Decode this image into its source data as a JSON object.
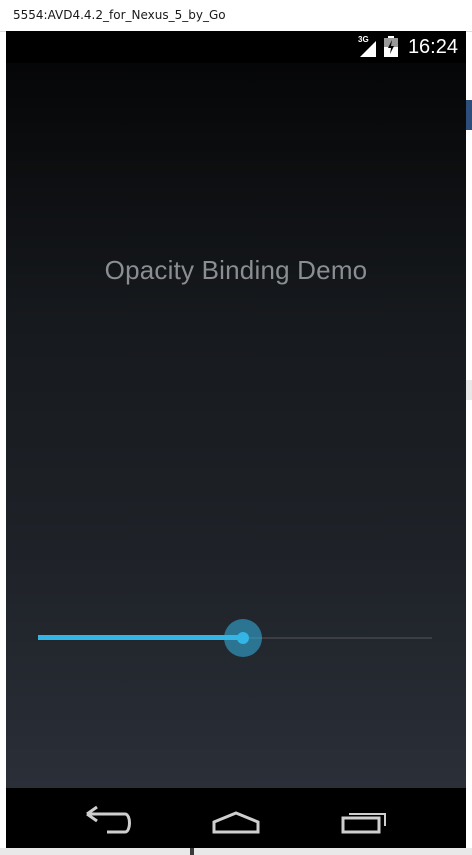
{
  "window": {
    "title": "5554:AVD4.4.2_for_Nexus_5_by_Go"
  },
  "statusbar": {
    "network": "3G",
    "time": "16:24",
    "icons": [
      "signal-icon",
      "battery-icon"
    ]
  },
  "app": {
    "title": "Opacity Binding Demo",
    "slider": {
      "value_fraction": 0.52,
      "accent": "#33b5e5"
    }
  },
  "navbar": {
    "buttons": [
      "back-icon",
      "home-icon",
      "recent-apps-icon"
    ]
  },
  "colors": {
    "accent": "#33b5e5",
    "title_text": "#8a8d91"
  }
}
